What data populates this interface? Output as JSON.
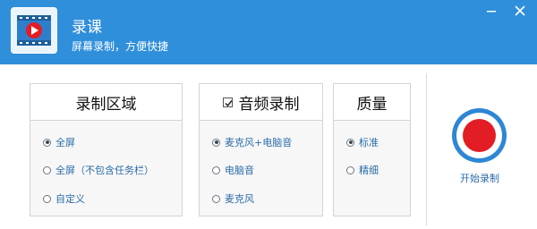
{
  "header": {
    "title": "录课",
    "subtitle": "屏幕录制，方便快捷",
    "icon": "video-play-icon",
    "minimize_icon": "minimize-icon",
    "close_icon": "close-icon"
  },
  "panels": {
    "region": {
      "title": "录制区域",
      "options": [
        {
          "label": "全屏",
          "selected": true
        },
        {
          "label": "全屏（不包含任务栏）",
          "selected": false
        },
        {
          "label": "自定义",
          "selected": false
        }
      ]
    },
    "audio": {
      "title": "音频录制",
      "enabled": true,
      "options": [
        {
          "label": "麦克风+电脑音",
          "selected": true
        },
        {
          "label": "电脑音",
          "selected": false
        },
        {
          "label": "麦克风",
          "selected": false
        }
      ]
    },
    "quality": {
      "title": "质量",
      "options": [
        {
          "label": "标准",
          "selected": true
        },
        {
          "label": "精细",
          "selected": false
        }
      ]
    }
  },
  "record": {
    "label": "开始录制"
  },
  "colors": {
    "header_blue": "#2f8fdb",
    "record_red": "#e31d25",
    "link_blue": "#2b6ea8"
  }
}
